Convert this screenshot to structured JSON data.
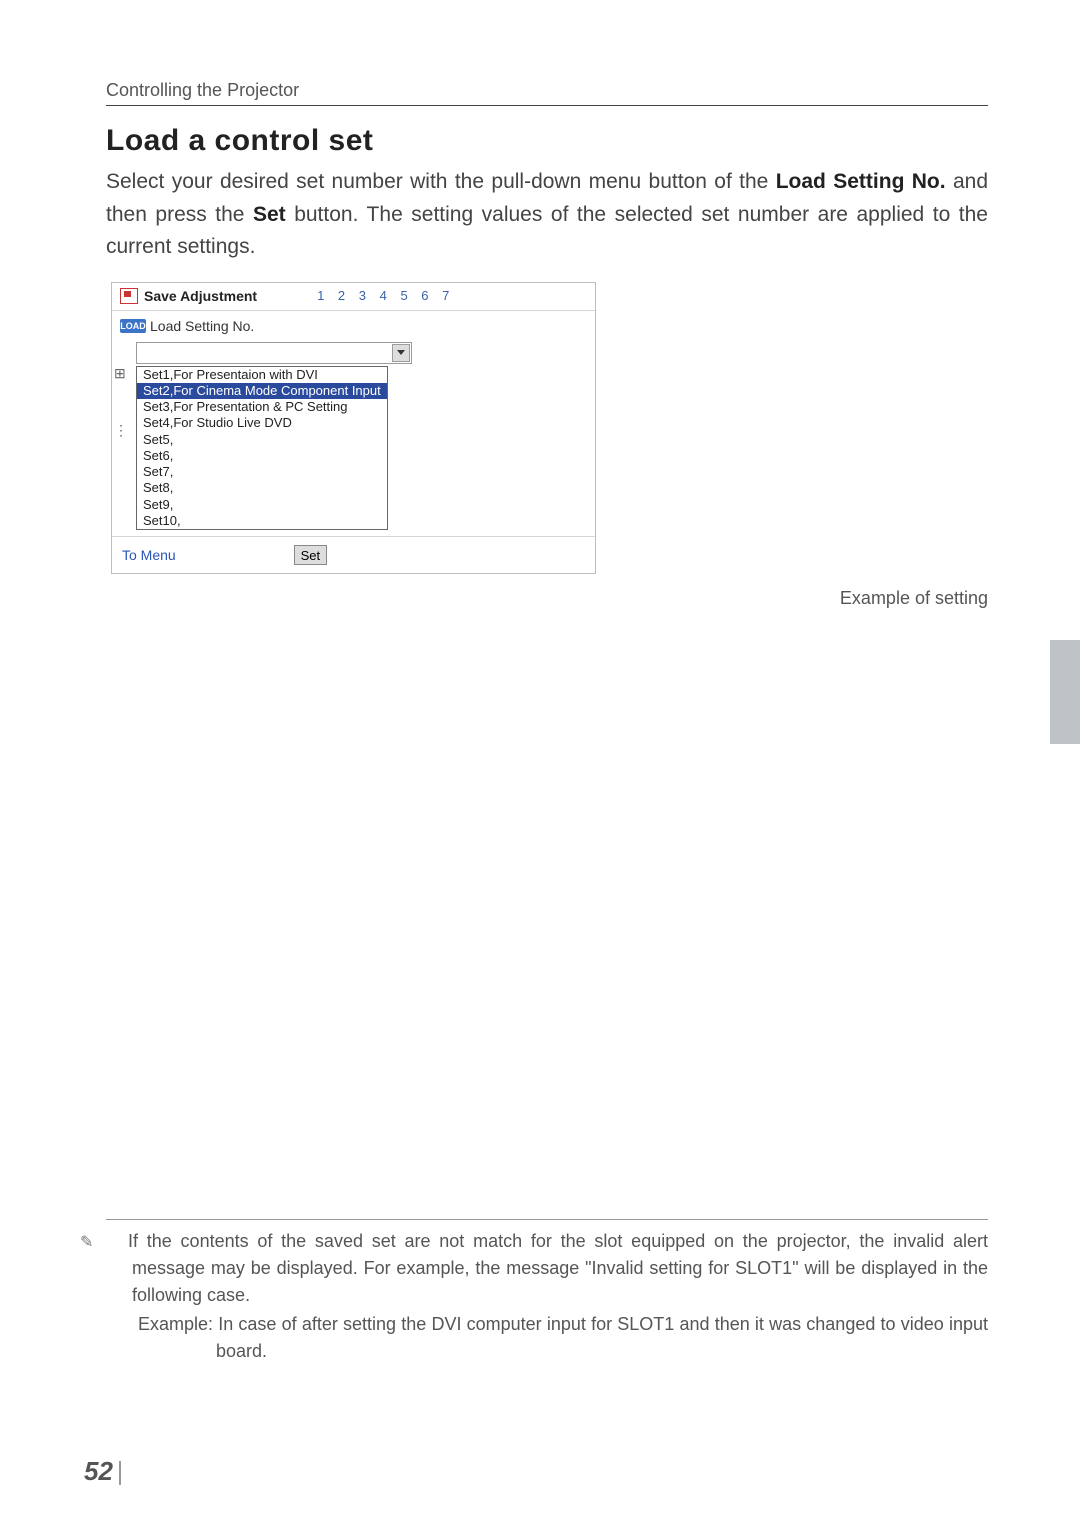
{
  "header": {
    "section": "Controlling the Projector"
  },
  "heading": "Load a control set",
  "body": {
    "pre1": "Select your desired set number with the pull-down menu button of the ",
    "b1": "Load Setting No.",
    "mid": " and then press the ",
    "b2": "Set",
    "post": " button. The setting values of the selected set number are applied to the current settings."
  },
  "panel": {
    "saveTitle": "Save Adjustment",
    "pages": "1 2 3 4 5 6 7",
    "loadBadge": "LOAD",
    "loadLabel": "Load Setting No.",
    "options": [
      "Set1,For Presentaion with DVI",
      "Set2,For Cinema Mode Component Input",
      "Set3,For Presentation & PC Setting",
      "Set4,For Studio Live DVD",
      "Set5,",
      "Set6,",
      "Set7,",
      "Set8,",
      "Set9,",
      "Set10,"
    ],
    "highlightIndex": 1,
    "toMenu": "To Menu",
    "setBtn": "Set"
  },
  "caption": "Example of setting",
  "footnote": {
    "line1": "If the contents of the saved set are not match for the slot equipped on the projector, the invalid alert message may be displayed. For example, the message \"Invalid setting for SLOT1\" will be displayed in the following case.",
    "line2a": "Example: ",
    "line2b": "In case of after setting the DVI computer input for SLOT1 and then it was changed to video input board."
  },
  "pageNumber": "52"
}
